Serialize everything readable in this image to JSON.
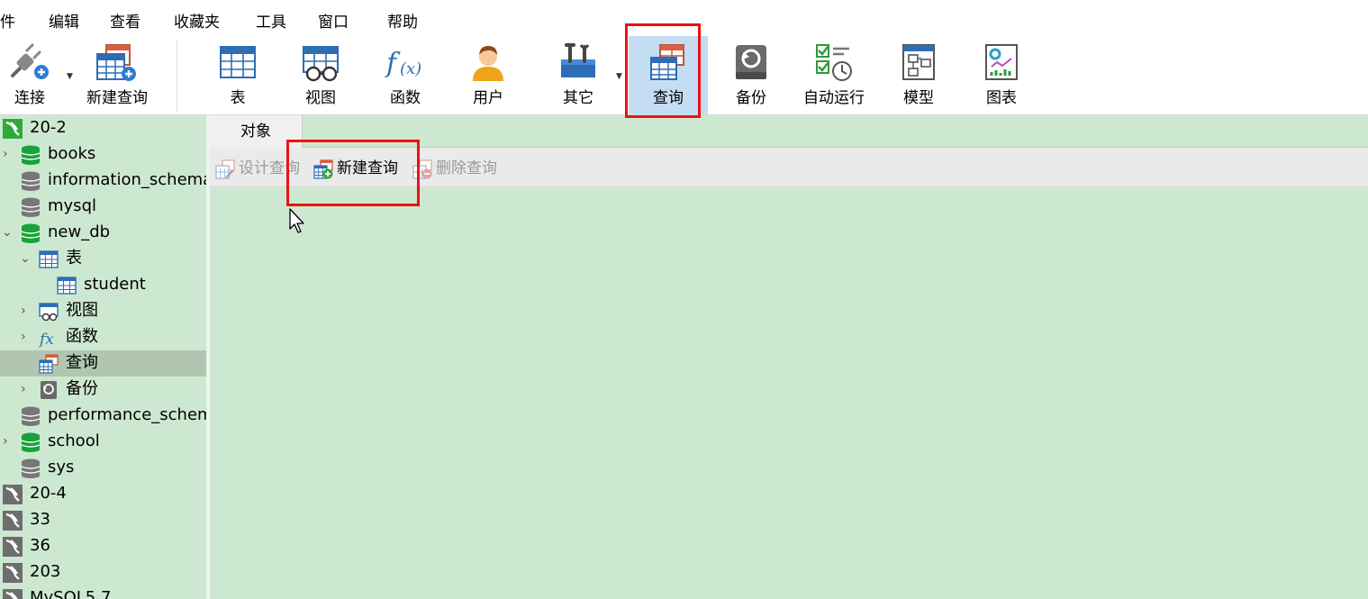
{
  "menu": {
    "items": [
      "件",
      "编辑",
      "查看",
      "收藏夹",
      "工具",
      "窗口",
      "帮助"
    ]
  },
  "toolbar": {
    "connect_label": "连接",
    "new_query_label": "新建查询",
    "table_label": "表",
    "view_label": "视图",
    "function_label": "函数",
    "user_label": "用户",
    "other_label": "其它",
    "query_label": "查询",
    "backup_label": "备份",
    "automation_label": "自动运行",
    "model_label": "模型",
    "chart_label": "图表"
  },
  "sidebar": {
    "items": [
      {
        "label": "20-2"
      },
      {
        "label": "books"
      },
      {
        "label": "information_schema"
      },
      {
        "label": "mysql"
      },
      {
        "label": "new_db"
      },
      {
        "label": "表"
      },
      {
        "label": "student"
      },
      {
        "label": "视图"
      },
      {
        "label": "函数"
      },
      {
        "label": "查询"
      },
      {
        "label": "备份"
      },
      {
        "label": "performance_schema"
      },
      {
        "label": "school"
      },
      {
        "label": "sys"
      },
      {
        "label": "20-4"
      },
      {
        "label": "33"
      },
      {
        "label": "36"
      },
      {
        "label": "203"
      },
      {
        "label": "MySQL5.7"
      }
    ]
  },
  "main": {
    "tab_object": "对象",
    "design_query": "设计查询",
    "new_query": "新建查询",
    "delete_query": "删除查询"
  },
  "colors": {
    "panel_bg": "#cde8d0",
    "selected_row": "#b1c6b0",
    "active_tool": "#c5ddf2",
    "highlight": "#ee1111"
  }
}
